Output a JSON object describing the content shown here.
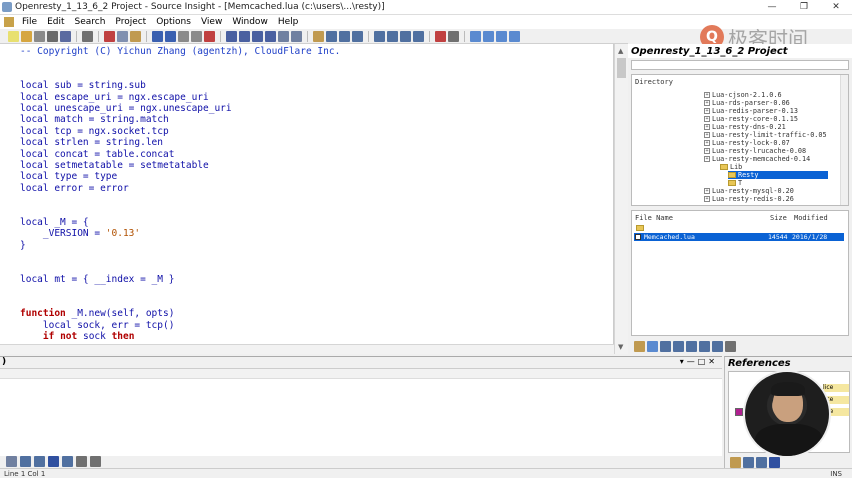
{
  "window": {
    "title": "Openresty_1_13_6_2 Project - Source Insight - [Memcached.lua (c:\\users\\...\\resty)]",
    "min_label": "—",
    "max_label": "❐",
    "close_label": "✕"
  },
  "menu": [
    "File",
    "Edit",
    "Search",
    "Project",
    "Options",
    "View",
    "Window",
    "Help"
  ],
  "code": {
    "lines": [
      {
        "text": "-- Copyright (C) Yichun Zhang (agentzh), CloudFlare Inc.",
        "kind": "comment"
      },
      {
        "text": "",
        "kind": "plain"
      },
      {
        "text": "",
        "kind": "plain"
      },
      {
        "text": "local sub = string.sub",
        "kind": "local"
      },
      {
        "text": "local escape_uri = ngx.escape_uri",
        "kind": "local"
      },
      {
        "text": "local unescape_uri = ngx.unescape_uri",
        "kind": "local"
      },
      {
        "text": "local match = string.match",
        "kind": "local"
      },
      {
        "text": "local tcp = ngx.socket.tcp",
        "kind": "local"
      },
      {
        "text": "local strlen = string.len",
        "kind": "local"
      },
      {
        "text": "local concat = table.concat",
        "kind": "local"
      },
      {
        "text": "local setmetatable = setmetatable",
        "kind": "local"
      },
      {
        "text": "local type = type",
        "kind": "local"
      },
      {
        "text": "local error = error",
        "kind": "local"
      },
      {
        "text": "",
        "kind": "plain"
      },
      {
        "text": "",
        "kind": "plain"
      },
      {
        "text": "local _M = {",
        "kind": "local"
      },
      {
        "text": "    _VERSION = '0.13'",
        "kind": "version"
      },
      {
        "text": "}",
        "kind": "plain"
      },
      {
        "text": "",
        "kind": "plain"
      },
      {
        "text": "",
        "kind": "plain"
      },
      {
        "text": "local mt = { __index = _M }",
        "kind": "local"
      },
      {
        "text": "",
        "kind": "plain"
      },
      {
        "text": "",
        "kind": "plain"
      },
      {
        "text": "function _M.new(self, opts)",
        "kind": "function"
      },
      {
        "text": "    local sock, err = tcp()",
        "kind": "local"
      },
      {
        "text": "    if not sock then",
        "kind": "if"
      }
    ]
  },
  "project": {
    "title": "Openresty_1_13_6_2 Project",
    "directory_label": "Directory",
    "tree": [
      {
        "label": "Lua-cjson-2.1.0.6",
        "type": "plus"
      },
      {
        "label": "Lua-rds-parser-0.06",
        "type": "plus"
      },
      {
        "label": "Lua-redis-parser-0.13",
        "type": "plus"
      },
      {
        "label": "Lua-resty-core-0.1.15",
        "type": "plus"
      },
      {
        "label": "Lua-resty-dns-0.21",
        "type": "plus"
      },
      {
        "label": "Lua-resty-limit-traffic-0.05",
        "type": "plus"
      },
      {
        "label": "Lua-resty-lock-0.07",
        "type": "plus"
      },
      {
        "label": "Lua-resty-lrucache-0.08",
        "type": "plus"
      },
      {
        "label": "Lua-resty-memcached-0.14",
        "type": "plus"
      },
      {
        "label": "Lib",
        "type": "folder"
      },
      {
        "label": "Resty",
        "type": "folder-selected"
      },
      {
        "label": "T",
        "type": "folder"
      },
      {
        "label": "Lua-resty-mysql-0.20",
        "type": "plus"
      },
      {
        "label": "Lua-resty-redis-0.26",
        "type": "plus"
      }
    ],
    "file_headers": {
      "name": "File Name",
      "size": "Size",
      "modified": "Modified"
    },
    "files": [
      {
        "name": "Memcached.lua",
        "size": "14544",
        "modified": "2016/1/28"
      }
    ]
  },
  "references": {
    "title": "References",
    "rows": [
      "lice",
      "lice",
      "lice"
    ]
  },
  "watermark": {
    "logo_glyph": "Q",
    "text": "极客时间"
  },
  "status": {
    "position": "Line 1  Col 1",
    "mode": "INS"
  },
  "colors": {
    "selection": "#0a62d4",
    "keyword": "#b00000",
    "identifier": "#1010a8",
    "comment": "#2040c8"
  }
}
